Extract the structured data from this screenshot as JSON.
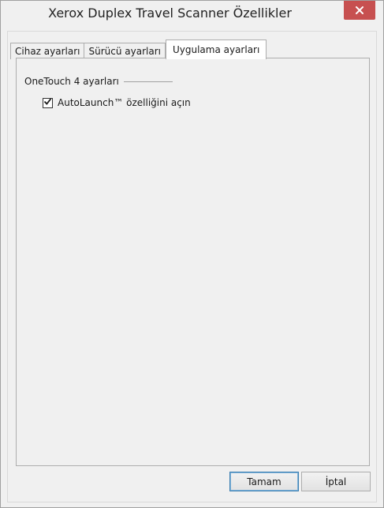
{
  "window": {
    "title": "Xerox Duplex Travel Scanner Özellikler"
  },
  "tabs": [
    {
      "label": "Cihaz ayarları",
      "active": false
    },
    {
      "label": "Sürücü ayarları",
      "active": false
    },
    {
      "label": "Uygulama ayarları",
      "active": true
    }
  ],
  "group": {
    "title": "OneTouch 4 ayarları"
  },
  "autolaunch": {
    "label": "AutoLaunch™ özelliğini açın",
    "checked": true
  },
  "buttons": {
    "ok": "Tamam",
    "cancel": "İptal"
  },
  "colors": {
    "close_button": "#c75050",
    "default_button_border": "#3c7fb1"
  },
  "icons": {
    "close": "close-icon",
    "check": "checkmark-icon"
  }
}
